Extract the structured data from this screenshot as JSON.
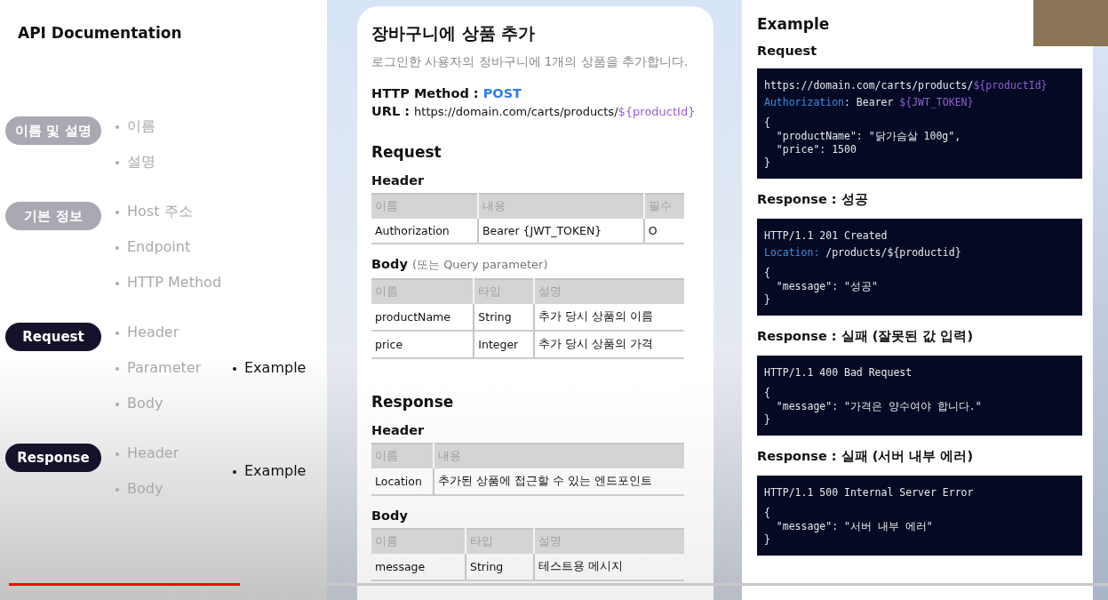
{
  "outline": {
    "title": "API Documentation",
    "sections": [
      {
        "label": "이름 및 설명",
        "active": false,
        "items": [
          "이름",
          "설명"
        ]
      },
      {
        "label": "기본 정보",
        "active": false,
        "items": [
          "Host 주소",
          "Endpoint",
          "HTTP Method"
        ]
      },
      {
        "label": "Request",
        "active": true,
        "items": [
          "Header",
          "Parameter",
          "Body"
        ],
        "example": "Example"
      },
      {
        "label": "Response",
        "active": true,
        "items": [
          "Header",
          "Body"
        ],
        "example": "Example"
      }
    ]
  },
  "api_card": {
    "title": "장바구니에 상품 추가",
    "description": "로그인한 사용자의 장바구니에 1개의 상품을 추가합니다.",
    "method_label": "HTTP Method :",
    "method": "POST",
    "url_label": "URL :",
    "url": "https://domain.com/carts/products/",
    "url_param": "${productId}",
    "sections": [
      {
        "heading": "Request",
        "tables": [
          {
            "heading": "Header",
            "columns": [
              "이름",
              "내용",
              "필수"
            ],
            "rows": [
              [
                "Authorization",
                "Bearer {JWT_TOKEN}",
                "O"
              ]
            ]
          },
          {
            "heading": "Body",
            "note": "(또는 Query parameter)",
            "columns": [
              "이름",
              "타입",
              "설명"
            ],
            "rows": [
              [
                "productName",
                "String",
                "추가 당시 상품의 이름"
              ],
              [
                "price",
                "Integer",
                "추가 당시 상품의 가격"
              ]
            ]
          }
        ]
      },
      {
        "heading": "Response",
        "tables": [
          {
            "heading": "Header",
            "columns": [
              "이름",
              "내용"
            ],
            "rows": [
              [
                "Location",
                "추가된 상품에 접근할 수 있는 엔드포인트"
              ]
            ]
          },
          {
            "heading": "Body",
            "columns": [
              "이름",
              "타입",
              "설명"
            ],
            "rows": [
              [
                "message",
                "String",
                "테스트용 메시지"
              ]
            ]
          }
        ]
      }
    ]
  },
  "examples": {
    "title": "Example",
    "blocks": [
      {
        "heading": "Request",
        "head": [
          [
            {
              "kind": "plain",
              "text": "https://domain.com/carts/products/"
            },
            {
              "kind": "var",
              "text": "${productId}"
            }
          ],
          [
            {
              "kind": "key",
              "text": "Authorization"
            },
            {
              "kind": "plain",
              "text": ": Bearer "
            },
            {
              "kind": "var",
              "text": "${JWT_TOKEN}"
            }
          ]
        ],
        "body": [
          "{",
          "  \"productName\": \"닭가슴살 100g\",",
          "  \"price\": 1500",
          "}"
        ]
      },
      {
        "heading": "Response : 성공",
        "head": [
          [
            {
              "kind": "plain",
              "text": "HTTP/1.1 201 Created"
            }
          ],
          [
            {
              "kind": "key",
              "text": "Location:"
            },
            {
              "kind": "plain",
              "text": " /products/${productid}"
            }
          ]
        ],
        "body": [
          "{",
          "  \"message\": \"성공\"",
          "}"
        ]
      },
      {
        "heading": "Response : 실패 (잘못된 값 입력)",
        "head": [
          [
            {
              "kind": "plain",
              "text": "HTTP/1.1 400 Bad Request"
            }
          ]
        ],
        "body": [
          "{",
          "  \"message\": \"가격은 양수여야 합니다.\"",
          "}"
        ]
      },
      {
        "heading": "Response : 실패 (서버 내부 에러)",
        "head": [
          [
            {
              "kind": "plain",
              "text": "HTTP/1.1 500 Internal Server Error"
            }
          ]
        ],
        "body": [
          "{",
          "  \"message\": \"서버 내부 에러\"",
          "}"
        ]
      }
    ]
  },
  "video_progress": {
    "level": 0.21
  }
}
